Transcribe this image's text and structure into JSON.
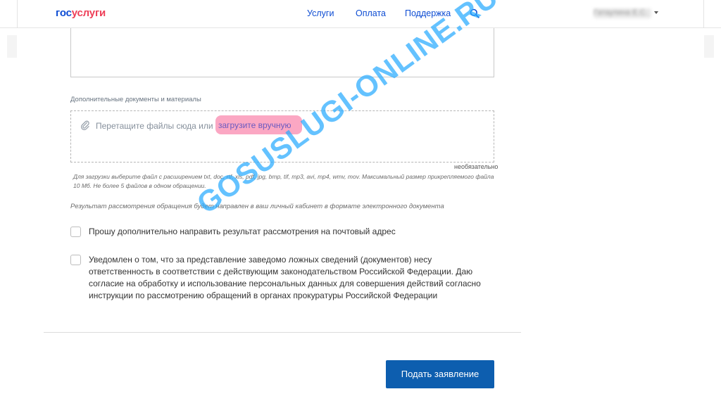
{
  "header": {
    "logo_part1": "гос",
    "logo_part2": "услуги",
    "nav": [
      "Услуги",
      "Оплата",
      "Поддержка"
    ],
    "user_name": "Гатаулина Е.С."
  },
  "form": {
    "attachments_label": "Дополнительные документы и материалы",
    "dropzone_text": "Перетащите файлы сюда или",
    "upload_link": "загрузите вручную",
    "optional_label": "необязательно",
    "upload_hint": "Для загрузки выберите файл с расширением txt, doc, rtf, xls, pdf, jpg, bmp, tif, mp3, avi, mp4, wmv, mov. Максимальный размер прикрепляемого файла 10 Мб. Не более 5 файлов в одном обращении.",
    "result_note": "Результат рассмотрения обращения будет направлен в ваш личный кабинет в формате электронного документа",
    "checkbox_postal": "Прошу дополнительно направить результат рассмотрения на почтовый адрес",
    "checkbox_consent": "Уведомлен о том, что за представление заведомо ложных сведений (документов) несу ответственность в соответствии с действующим законодательством Российской Федерации. Даю согласие на обработку и использование персональных данных для совершения действий согласно инструкции по рассмотрению обращений в органах прокуратуры Российской Федерации",
    "submit": "Подать заявление"
  },
  "watermark": "GOSUSLUGI-ONLINE.RU",
  "colors": {
    "brand_blue": "#0d4cd3",
    "brand_red": "#ee3f58",
    "button": "#0d5eaf",
    "highlight": "#fba7c3",
    "watermark": "#28aaff"
  }
}
